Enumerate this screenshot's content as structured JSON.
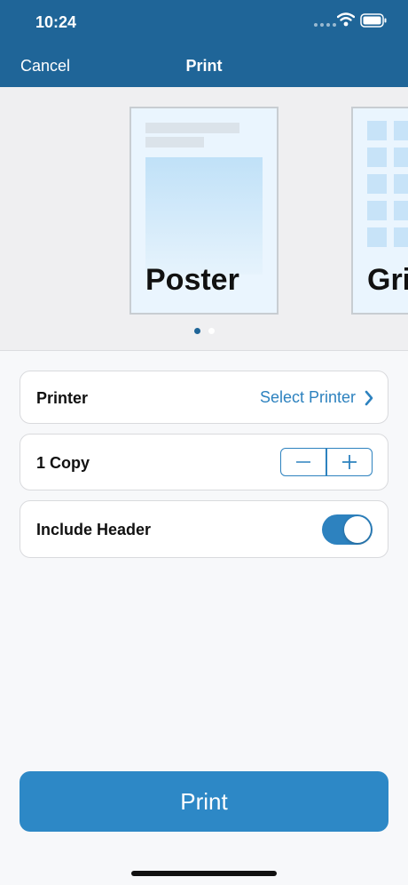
{
  "status_bar": {
    "time": "10:24"
  },
  "nav": {
    "cancel_label": "Cancel",
    "title": "Print"
  },
  "carousel": {
    "cards": [
      {
        "label": "Poster"
      },
      {
        "label": "Grid"
      }
    ],
    "page_count": 2,
    "active_page": 1
  },
  "printer_row": {
    "label": "Printer",
    "value": "Select Printer"
  },
  "copies_row": {
    "label": "1 Copy",
    "decrement_symbol": "−",
    "increment_symbol": "+"
  },
  "header_row": {
    "label": "Include Header",
    "toggle_on": true
  },
  "print_button": {
    "label": "Print"
  },
  "colors": {
    "nav_background": "#1f6598",
    "accent": "#2d82bf",
    "button": "#2d88c6"
  }
}
